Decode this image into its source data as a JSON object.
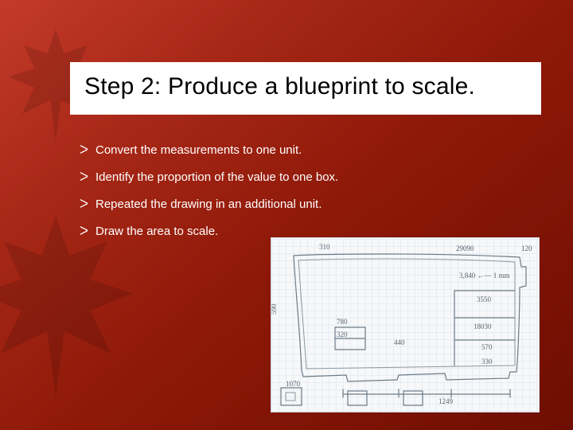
{
  "slide": {
    "title": "Step 2: Produce a blueprint to scale.",
    "bullets": [
      "Convert the measurements to one unit.",
      "Identify the proportion of the value to one box.",
      "Repeated the drawing in an additional unit.",
      "Draw the area to scale."
    ],
    "sketch_labels": {
      "top_left": "310",
      "top_right": "29090",
      "far_right_top": "120",
      "left_side": "590",
      "mid_right": "3,840 ←— 1 mm",
      "inner_right_a": "3550",
      "inner_right_b": "18030",
      "inner_right_c": "570",
      "inner_right_d": "330",
      "small_box_a": "780",
      "small_box_b": "320",
      "center": "440",
      "bottom_center": "1249",
      "tiny_box": "1070"
    }
  }
}
